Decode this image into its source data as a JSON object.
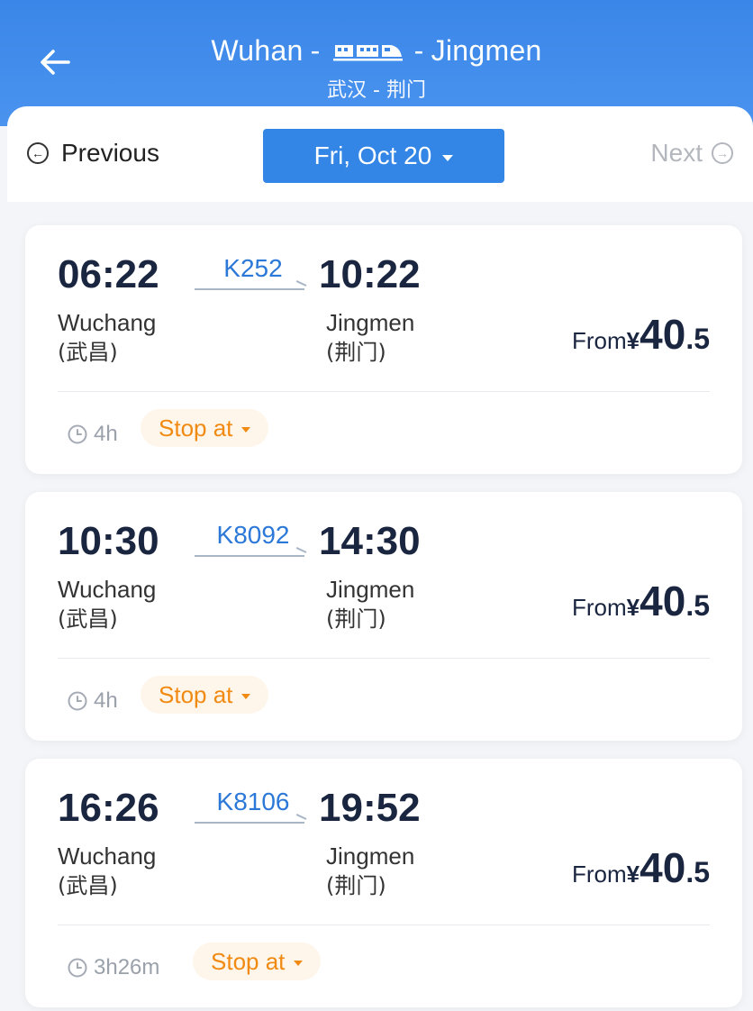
{
  "header": {
    "from_city": "Wuhan",
    "to_city": "Jingmen",
    "dash": "-",
    "subtitle": "武汉 - 荆门",
    "back_icon": "arrow-left-icon",
    "train_icon": "train-icon",
    "bg_color": "#3a86e8"
  },
  "datebar": {
    "previous_label": "Previous",
    "next_label": "Next",
    "date_label": "Fri, Oct 20",
    "accent": "#3385e6"
  },
  "trains": [
    {
      "dep_time": "06:22",
      "arr_time": "10:22",
      "train_no": "K252",
      "dep_station": "Wuchang",
      "dep_station_cn": "(武昌)",
      "arr_station": "Jingmen",
      "arr_station_cn": "(荆门)",
      "from_label": "From",
      "currency": "¥",
      "price_int": "40",
      "price_dec": ".5",
      "duration": "4h",
      "stop_label": "Stop at"
    },
    {
      "dep_time": "10:30",
      "arr_time": "14:30",
      "train_no": "K8092",
      "dep_station": "Wuchang",
      "dep_station_cn": "(武昌)",
      "arr_station": "Jingmen",
      "arr_station_cn": "(荆门)",
      "from_label": "From",
      "currency": "¥",
      "price_int": "40",
      "price_dec": ".5",
      "duration": "4h",
      "stop_label": "Stop at"
    },
    {
      "dep_time": "16:26",
      "arr_time": "19:52",
      "train_no": "K8106",
      "dep_station": "Wuchang",
      "dep_station_cn": "(武昌)",
      "arr_station": "Jingmen",
      "arr_station_cn": "(荆门)",
      "from_label": "From",
      "currency": "¥",
      "price_int": "40",
      "price_dec": ".5",
      "duration": "3h26m",
      "stop_label": "Stop at"
    }
  ]
}
